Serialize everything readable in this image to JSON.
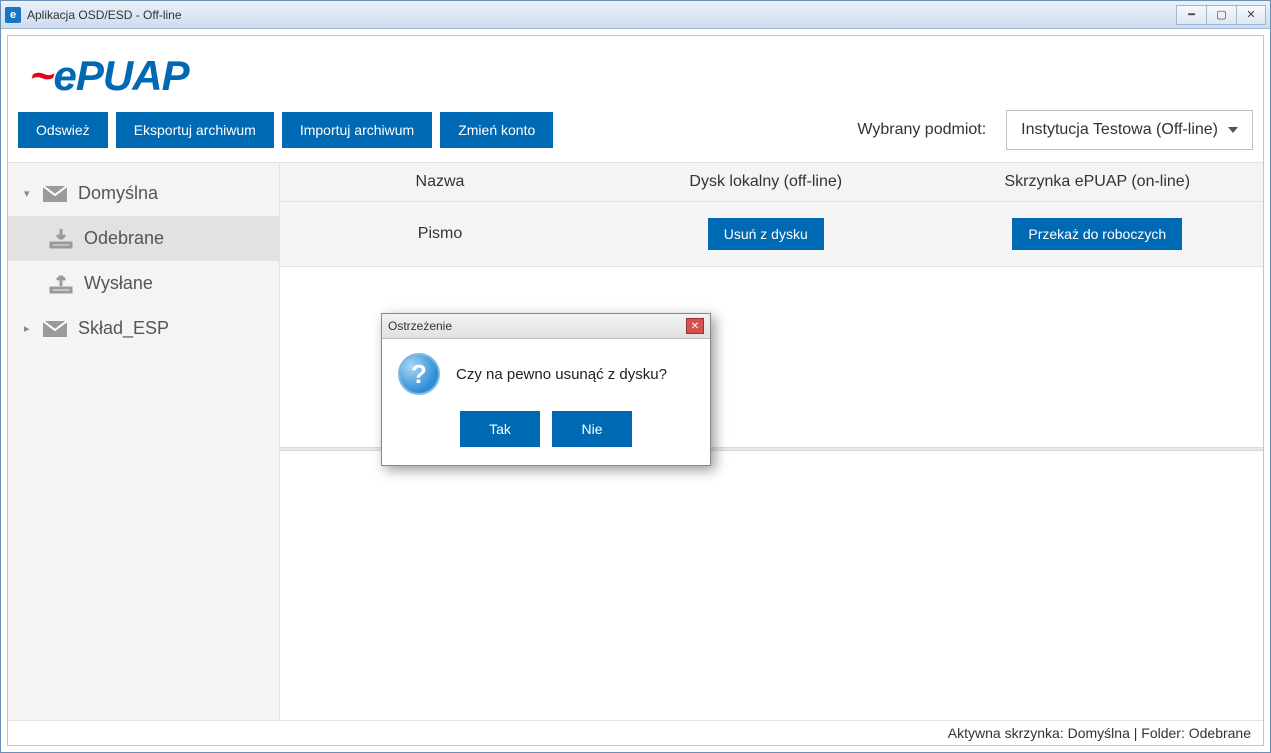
{
  "window": {
    "title": "Aplikacja OSD/ESD - Off-line",
    "app_icon_letter": "e"
  },
  "logo": {
    "text": "ePUAP"
  },
  "toolbar": {
    "refresh": "Odswież",
    "export": "Eksportuj archiwum",
    "import": "Importuj archiwum",
    "change_account": "Zmień konto",
    "entity_label": "Wybrany podmiot:",
    "entity_value": "Instytucja Testowa (Off-line)"
  },
  "sidebar": {
    "items": [
      {
        "label": "Domyślna"
      },
      {
        "label": "Odebrane"
      },
      {
        "label": "Wysłane"
      },
      {
        "label": "Skład_ESP"
      }
    ]
  },
  "table": {
    "headers": {
      "name": "Nazwa",
      "local": "Dysk lokalny (off-line)",
      "remote": "Skrzynka ePUAP (on-line)"
    },
    "rows": [
      {
        "name": "Pismo",
        "local_btn": "Usuń z dysku",
        "remote_btn": "Przekaż do roboczych"
      }
    ]
  },
  "dialog": {
    "title": "Ostrzeżenie",
    "message": "Czy na pewno usunąć z dysku?",
    "yes": "Tak",
    "no": "Nie"
  },
  "status": "Aktywna skrzynka: Domyślna | Folder: Odebrane"
}
